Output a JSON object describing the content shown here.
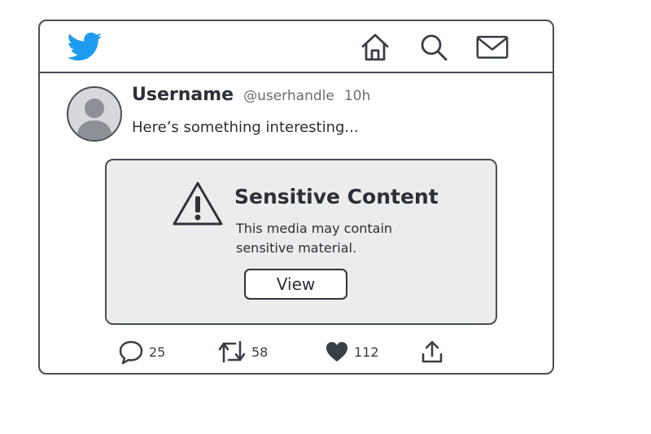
{
  "header": {
    "logo_icon": "bird-icon",
    "logo_color": "#1d9bf0",
    "nav": [
      {
        "icon": "home-icon"
      },
      {
        "icon": "search-icon"
      },
      {
        "icon": "mail-icon"
      }
    ]
  },
  "tweet": {
    "avatar_icon": "user-avatar-icon",
    "username": "Username",
    "handle": "@userhandle",
    "time": "10h",
    "text": "Here’s something interesting..."
  },
  "sensitive": {
    "icon": "warning-icon",
    "title": "Sensitive Content",
    "desc_line1": "This media may contain",
    "desc_line2": "sensitive material.",
    "button_label": "View"
  },
  "actions": {
    "reply": {
      "icon": "reply-icon",
      "count": "25"
    },
    "retweet": {
      "icon": "retweet-icon",
      "count": "58"
    },
    "like": {
      "icon": "heart-icon",
      "count": "112"
    },
    "share": {
      "icon": "share-icon"
    }
  }
}
